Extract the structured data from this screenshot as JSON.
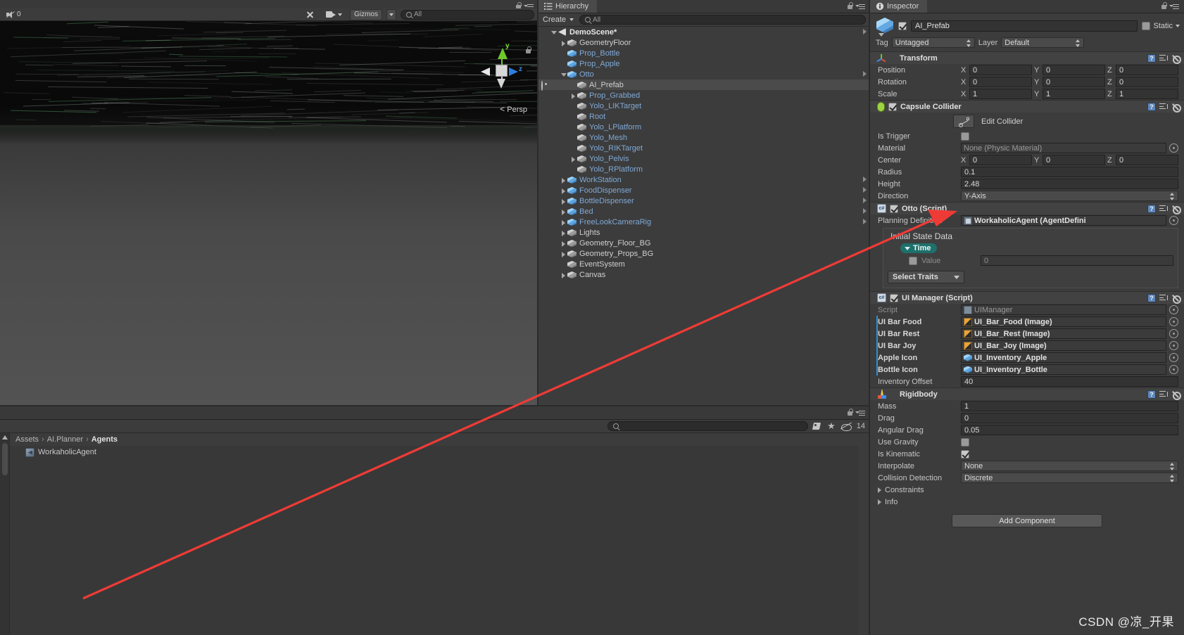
{
  "scene": {
    "toolbar": {
      "audio_label": "0",
      "gizmos_label": "Gizmos",
      "search_placeholder": "All"
    },
    "gizmo": {
      "y_axis": "y",
      "z_axis": "z"
    },
    "persp_label": "Persp"
  },
  "hierarchy": {
    "tab_label": "Hierarchy",
    "create_label": "Create",
    "search_placeholder": "All",
    "items": [
      {
        "name": "DemoScene*",
        "depth": 0,
        "fold": "open",
        "icon": "scene",
        "style": "bold",
        "eye": false,
        "arrow": true,
        "selected": false
      },
      {
        "name": "GeometryFloor",
        "depth": 1,
        "fold": "closed",
        "icon": "cube-grey",
        "style": "white",
        "eye": false,
        "arrow": false,
        "selected": false
      },
      {
        "name": "Prop_Bottle",
        "depth": 1,
        "fold": "none",
        "icon": "cube-blue",
        "style": "blue",
        "eye": false,
        "arrow": false,
        "selected": false
      },
      {
        "name": "Prop_Apple",
        "depth": 1,
        "fold": "none",
        "icon": "cube-blue",
        "style": "blue",
        "eye": false,
        "arrow": false,
        "selected": false
      },
      {
        "name": "Otto",
        "depth": 1,
        "fold": "open",
        "icon": "cube-blue",
        "style": "blue",
        "eye": false,
        "arrow": true,
        "selected": false
      },
      {
        "name": "AI_Prefab",
        "depth": 2,
        "fold": "none",
        "icon": "cube-grey",
        "style": "white",
        "eye": true,
        "arrow": false,
        "selected": true
      },
      {
        "name": "Prop_Grabbed",
        "depth": 2,
        "fold": "closed",
        "icon": "cube-grey",
        "style": "blue",
        "eye": false,
        "arrow": false,
        "selected": false
      },
      {
        "name": "Yolo_LIKTarget",
        "depth": 2,
        "fold": "none",
        "icon": "cube-grey",
        "style": "blue",
        "eye": false,
        "arrow": false,
        "selected": false
      },
      {
        "name": "Root",
        "depth": 2,
        "fold": "none",
        "icon": "cube-grey",
        "style": "blue",
        "eye": false,
        "arrow": false,
        "selected": false
      },
      {
        "name": "Yolo_LPlatform",
        "depth": 2,
        "fold": "none",
        "icon": "cube-grey",
        "style": "blue",
        "eye": false,
        "arrow": false,
        "selected": false
      },
      {
        "name": "Yolo_Mesh",
        "depth": 2,
        "fold": "none",
        "icon": "cube-grey",
        "style": "blue",
        "eye": false,
        "arrow": false,
        "selected": false
      },
      {
        "name": "Yolo_RIKTarget",
        "depth": 2,
        "fold": "none",
        "icon": "cube-grey",
        "style": "blue",
        "eye": false,
        "arrow": false,
        "selected": false
      },
      {
        "name": "Yolo_Pelvis",
        "depth": 2,
        "fold": "closed",
        "icon": "cube-grey",
        "style": "blue",
        "eye": false,
        "arrow": false,
        "selected": false
      },
      {
        "name": "Yolo_RPlatform",
        "depth": 2,
        "fold": "none",
        "icon": "cube-grey",
        "style": "blue",
        "eye": false,
        "arrow": false,
        "selected": false
      },
      {
        "name": "WorkStation",
        "depth": 1,
        "fold": "closed",
        "icon": "cube-blue",
        "style": "blue",
        "eye": false,
        "arrow": true,
        "selected": false
      },
      {
        "name": "FoodDispenser",
        "depth": 1,
        "fold": "closed",
        "icon": "cube-blue",
        "style": "blue",
        "eye": false,
        "arrow": true,
        "selected": false
      },
      {
        "name": "BottleDispenser",
        "depth": 1,
        "fold": "closed",
        "icon": "cube-blue",
        "style": "blue",
        "eye": false,
        "arrow": true,
        "selected": false
      },
      {
        "name": "Bed",
        "depth": 1,
        "fold": "closed",
        "icon": "cube-blue",
        "style": "blue",
        "eye": false,
        "arrow": true,
        "selected": false
      },
      {
        "name": "FreeLookCameraRig",
        "depth": 1,
        "fold": "closed",
        "icon": "cube-blue",
        "style": "blue",
        "eye": false,
        "arrow": true,
        "selected": false
      },
      {
        "name": "Lights",
        "depth": 1,
        "fold": "closed",
        "icon": "cube-grey",
        "style": "white",
        "eye": false,
        "arrow": false,
        "selected": false
      },
      {
        "name": "Geometry_Floor_BG",
        "depth": 1,
        "fold": "closed",
        "icon": "cube-grey",
        "style": "white",
        "eye": false,
        "arrow": false,
        "selected": false
      },
      {
        "name": "Geometry_Props_BG",
        "depth": 1,
        "fold": "closed",
        "icon": "cube-grey",
        "style": "white",
        "eye": false,
        "arrow": false,
        "selected": false
      },
      {
        "name": "EventSystem",
        "depth": 1,
        "fold": "none",
        "icon": "cube-grey",
        "style": "white",
        "eye": false,
        "arrow": false,
        "selected": false
      },
      {
        "name": "Canvas",
        "depth": 1,
        "fold": "closed",
        "icon": "cube-grey",
        "style": "white",
        "eye": false,
        "arrow": false,
        "selected": false
      }
    ]
  },
  "project": {
    "search_placeholder": "",
    "hidden_count": "14",
    "breadcrumb": [
      "Assets",
      "AI.Planner",
      "Agents"
    ],
    "assets": [
      {
        "name": "WorkaholicAgent"
      }
    ]
  },
  "inspector": {
    "tab_label": "Inspector",
    "object_name": "AI_Prefab",
    "enabled": true,
    "static_label": "Static",
    "tag_label": "Tag",
    "tag_value": "Untagged",
    "layer_label": "Layer",
    "layer_value": "Default",
    "components": [
      {
        "title": "Transform",
        "icon": "transform-icon",
        "has_checkbox": false,
        "rows": [
          {
            "label": "Position",
            "type": "vector3",
            "x": "0",
            "y": "0",
            "z": "0"
          },
          {
            "label": "Rotation",
            "type": "vector3",
            "x": "0",
            "y": "0",
            "z": "0"
          },
          {
            "label": "Scale",
            "type": "vector3",
            "x": "1",
            "y": "1",
            "z": "1"
          }
        ]
      },
      {
        "title": "Capsule Collider",
        "icon": "capsule-icon",
        "has_checkbox": true,
        "checked": true,
        "edit_collider_label": "Edit Collider",
        "rows": [
          {
            "label": "Is Trigger",
            "type": "checkbox",
            "value": false
          },
          {
            "label": "Material",
            "type": "object",
            "value": "None (Physic Material)",
            "plain": true
          },
          {
            "label": "Center",
            "type": "vector3",
            "x": "0",
            "y": "0",
            "z": "0"
          },
          {
            "label": "Radius",
            "type": "text",
            "value": "0.1"
          },
          {
            "label": "Height",
            "type": "text",
            "value": "2.48"
          },
          {
            "label": "Direction",
            "type": "dropdown",
            "value": "Y-Axis"
          }
        ]
      },
      {
        "title": "Otto (Script)",
        "icon": "cs-script-icon",
        "has_checkbox": true,
        "checked": true,
        "rows": [
          {
            "label": "Planning Definition",
            "type": "object",
            "value": "WorkaholicAgent (AgentDefini",
            "icon": "sodata-icon"
          }
        ],
        "nested": {
          "title": "Initial State Data",
          "trait_pill": "Time",
          "value_label": "Value",
          "value": "0",
          "value_checked": false,
          "select_traits_label": "Select Traits"
        }
      },
      {
        "title": "UI Manager (Script)",
        "icon": "cs-script-icon",
        "has_checkbox": true,
        "checked": true,
        "rows": [
          {
            "label": "Script",
            "type": "object",
            "value": "UIManager",
            "plain": true,
            "icon": "script-icon",
            "dim_label": true
          },
          {
            "label": "UI Bar Food",
            "type": "object",
            "value": "UI_Bar_Food (Image)",
            "icon": "sprite-icon",
            "bold": true
          },
          {
            "label": "UI Bar Rest",
            "type": "object",
            "value": "UI_Bar_Rest (Image)",
            "icon": "sprite-icon",
            "bold": true
          },
          {
            "label": "UI Bar Joy",
            "type": "object",
            "value": "UI_Bar_Joy (Image)",
            "icon": "sprite-icon",
            "bold": true
          },
          {
            "label": "Apple Icon",
            "type": "object",
            "value": "UI_Inventory_Apple",
            "icon": "prefab-icon",
            "bold": true
          },
          {
            "label": "Bottle Icon",
            "type": "object",
            "value": "UI_Inventory_Bottle",
            "icon": "prefab-icon",
            "bold": true
          },
          {
            "label": "Inventory Offset",
            "type": "text",
            "value": "40"
          }
        ]
      },
      {
        "title": "Rigidbody",
        "icon": "rigidbody-icon",
        "has_checkbox": false,
        "rows": [
          {
            "label": "Mass",
            "type": "text",
            "value": "1"
          },
          {
            "label": "Drag",
            "type": "text",
            "value": "0"
          },
          {
            "label": "Angular Drag",
            "type": "text",
            "value": "0.05"
          },
          {
            "label": "Use Gravity",
            "type": "checkbox",
            "value": false
          },
          {
            "label": "Is Kinematic",
            "type": "checkbox",
            "value": true
          },
          {
            "label": "Interpolate",
            "type": "dropdown",
            "value": "None"
          },
          {
            "label": "Collision Detection",
            "type": "dropdown",
            "value": "Discrete"
          },
          {
            "label": "Constraints",
            "type": "foldout"
          },
          {
            "label": "Info",
            "type": "foldout"
          }
        ]
      }
    ],
    "add_component_label": "Add Component"
  },
  "watermark": "CSDN @凉_开果",
  "colors": {
    "accent_blue": "#2d8fd8",
    "annotation_red": "#ef3b36",
    "panel_bg": "#3c3c3c",
    "trait_teal": "#1f6f6b"
  }
}
